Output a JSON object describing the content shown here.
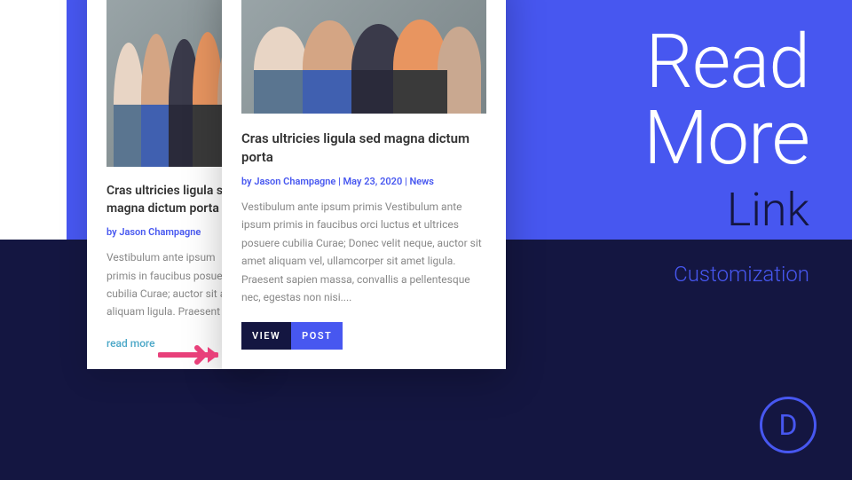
{
  "headline": {
    "read": "Read",
    "more": "More",
    "link": "Link",
    "customization": "Customization"
  },
  "card_back": {
    "title": "Cras ultricies ligula sed magna dictum porta",
    "meta": "by Jason Champagne",
    "body": "Vestibulum ante ipsum primis in faucibus posuere cubilia Curae; auctor sit amet aliquam ligula. Praesent sa",
    "read_more": "read more"
  },
  "card_front": {
    "title": "Cras ultricies ligula sed magna dictum porta",
    "meta": "by Jason Champagne | May 23, 2020 | News",
    "body": "Vestibulum ante ipsum primis Vestibulum ante ipsum primis in faucibus orci luctus et ultrices posuere cubilia Curae; Donec velit neque, auctor sit amet aliquam vel, ullamcorper sit amet ligula. Praesent sapien massa, convallis a pellentesque nec, egestas non nisi....",
    "button": {
      "view": "VIEW",
      "post": "POST"
    }
  },
  "logo": "D"
}
